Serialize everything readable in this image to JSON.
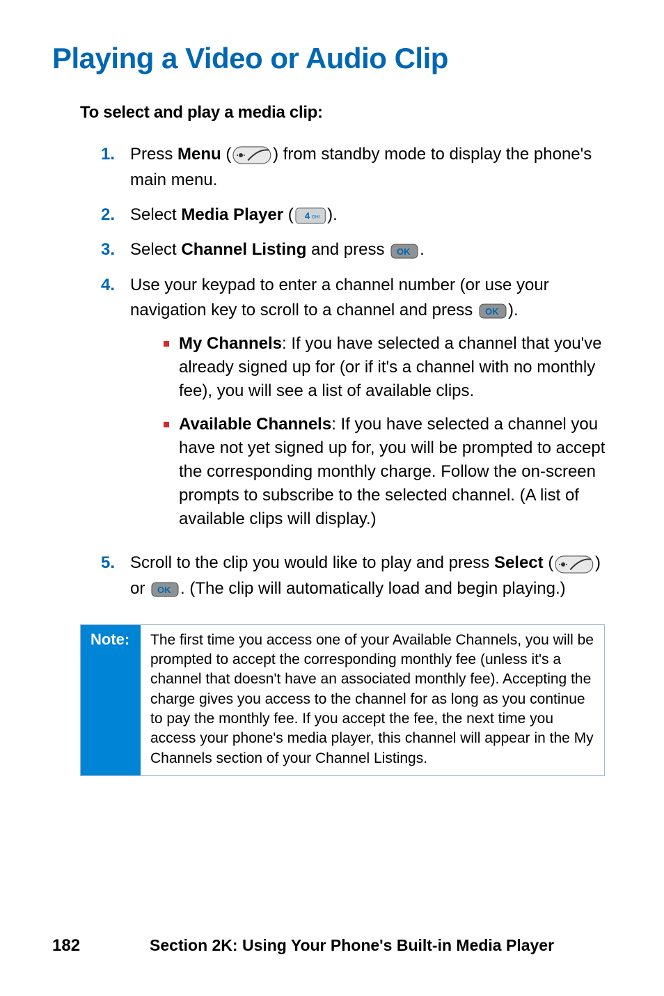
{
  "title": "Playing a Video or Audio Clip",
  "subtitle": "To select and play a media clip:",
  "steps": {
    "s1": {
      "num": "1.",
      "pre": "Press ",
      "bold1": "Menu",
      "mid": " (",
      "post": ") from standby mode to display the phone's main menu."
    },
    "s2": {
      "num": "2.",
      "pre": "Select ",
      "bold1": "Media Player",
      "mid": " (",
      "post": ")."
    },
    "s3": {
      "num": "3.",
      "pre": "Select ",
      "bold1": "Channel Listing",
      "mid": " and press ",
      "post": "."
    },
    "s4": {
      "num": "4.",
      "line1a": "Use your keypad to enter a channel number (or use your navigation key to scroll to a channel and press ",
      "line1b": ").",
      "b1_bold": "My Channels",
      "b1_text": ": If you have selected a channel that you've already signed up for (or if it's a channel with no monthly fee), you will see a list of available clips.",
      "b2_bold": "Available Channels",
      "b2_text": ": If you have selected a channel you have not yet signed up for, you will be prompted to accept the corresponding monthly charge. Follow the on-screen prompts to subscribe to the selected channel. (A list of available clips will display.)"
    },
    "s5": {
      "num": "5.",
      "pre": "Scroll to the clip you would like to play and press ",
      "bold1": "Select",
      "mid1": " (",
      "mid2": ") or ",
      "post": ". (The clip will automatically load and begin playing.)"
    }
  },
  "note": {
    "label": "Note:",
    "body": "The first time you access one of your Available Channels, you will be prompted to accept the corresponding monthly fee (unless it's a channel that doesn't have an associated monthly fee). Accepting the charge gives you access to the channel for as long as you continue to pay the monthly fee. If you accept the fee, the next time you access your phone's media player, this channel will appear in the My Channels section of your Channel Listings."
  },
  "footer": {
    "page": "182",
    "section": "Section 2K: Using Your Phone's Built-in Media Player"
  },
  "icons": {
    "softkey": "phone-softkey-icon",
    "ok": "ok-button-icon",
    "key4": "keypad-4-icon"
  }
}
